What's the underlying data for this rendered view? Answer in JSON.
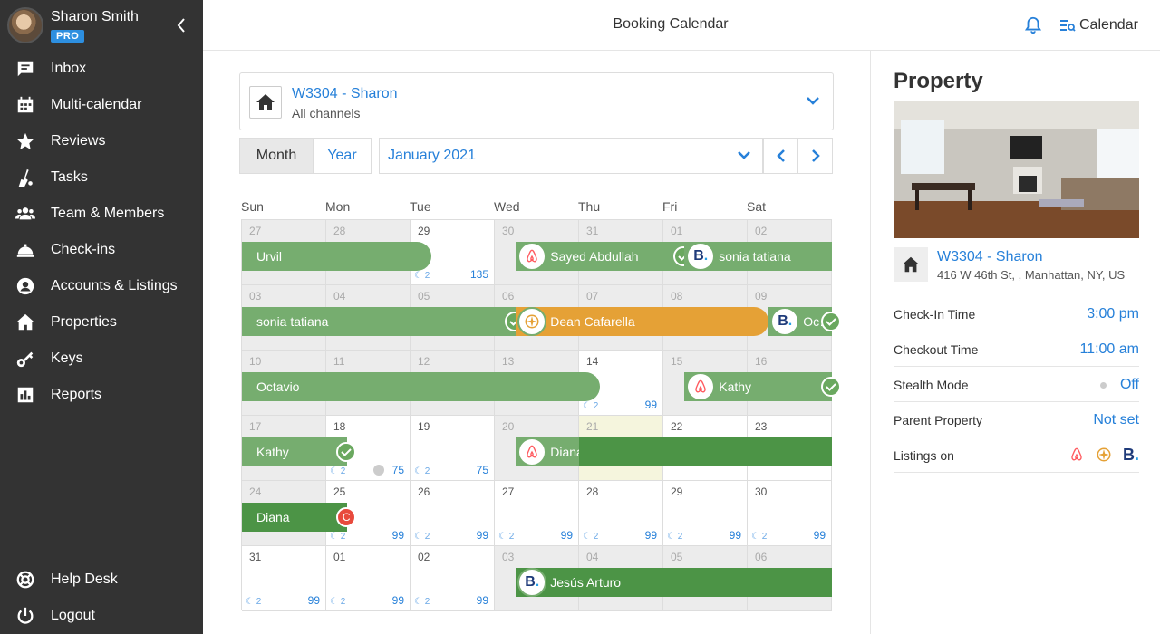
{
  "user": {
    "name": "Sharon Smith",
    "badge": "PRO"
  },
  "sidebar": {
    "items": [
      {
        "label": "Inbox",
        "icon": "inbox-icon"
      },
      {
        "label": "Multi-calendar",
        "icon": "calendar-grid-icon"
      },
      {
        "label": "Reviews",
        "icon": "star-icon"
      },
      {
        "label": "Tasks",
        "icon": "broom-icon"
      },
      {
        "label": "Team & Members",
        "icon": "team-icon"
      },
      {
        "label": "Check-ins",
        "icon": "bell-desk-icon"
      },
      {
        "label": "Accounts & Listings",
        "icon": "user-circle-icon"
      },
      {
        "label": "Properties",
        "icon": "home-icon"
      },
      {
        "label": "Keys",
        "icon": "key-icon"
      },
      {
        "label": "Reports",
        "icon": "reports-icon"
      }
    ],
    "bottom": [
      {
        "label": "Help Desk",
        "icon": "lifebuoy-icon"
      },
      {
        "label": "Logout",
        "icon": "power-icon"
      }
    ]
  },
  "header": {
    "title": "Booking Calendar",
    "calendar_label": "Calendar"
  },
  "property_selector": {
    "name": "W3304 - Sharon",
    "channels": "All channels"
  },
  "view": {
    "month_label": "Month",
    "year_label": "Year",
    "current": "January 2021"
  },
  "weekdays": [
    "Sun",
    "Mon",
    "Tue",
    "Wed",
    "Thu",
    "Fri",
    "Sat"
  ],
  "weeks": [
    [
      {
        "d": "27",
        "s": "past"
      },
      {
        "d": "28",
        "s": "past"
      },
      {
        "d": "29",
        "s": "fut",
        "moon": "2",
        "price": "135"
      },
      {
        "d": "30",
        "s": "past"
      },
      {
        "d": "31",
        "s": "past"
      },
      {
        "d": "01",
        "s": "past"
      },
      {
        "d": "02",
        "s": "past"
      }
    ],
    [
      {
        "d": "03",
        "s": "past"
      },
      {
        "d": "04",
        "s": "past"
      },
      {
        "d": "05",
        "s": "past"
      },
      {
        "d": "06",
        "s": "past"
      },
      {
        "d": "07",
        "s": "past"
      },
      {
        "d": "08",
        "s": "past"
      },
      {
        "d": "09",
        "s": "past"
      }
    ],
    [
      {
        "d": "10",
        "s": "past"
      },
      {
        "d": "11",
        "s": "past"
      },
      {
        "d": "12",
        "s": "past"
      },
      {
        "d": "13",
        "s": "past"
      },
      {
        "d": "14",
        "s": "fut",
        "moon": "2",
        "price": "99"
      },
      {
        "d": "15",
        "s": "past"
      },
      {
        "d": "16",
        "s": "past"
      }
    ],
    [
      {
        "d": "17",
        "s": "past"
      },
      {
        "d": "18",
        "s": "fut",
        "moon": "2",
        "price": "75",
        "dot": true
      },
      {
        "d": "19",
        "s": "fut",
        "moon": "2",
        "price": "75"
      },
      {
        "d": "20",
        "s": "past"
      },
      {
        "d": "21",
        "s": "today"
      },
      {
        "d": "22",
        "s": "fut"
      },
      {
        "d": "23",
        "s": "fut"
      }
    ],
    [
      {
        "d": "24",
        "s": "past"
      },
      {
        "d": "25",
        "s": "fut",
        "moon": "2",
        "price": "99"
      },
      {
        "d": "26",
        "s": "fut",
        "moon": "2",
        "price": "99"
      },
      {
        "d": "27",
        "s": "fut",
        "moon": "2",
        "price": "99"
      },
      {
        "d": "28",
        "s": "fut",
        "moon": "2",
        "price": "99"
      },
      {
        "d": "29",
        "s": "fut",
        "moon": "2",
        "price": "99"
      },
      {
        "d": "30",
        "s": "fut",
        "moon": "2",
        "price": "99"
      }
    ],
    [
      {
        "d": "31",
        "s": "fut",
        "moon": "2",
        "price": "99"
      },
      {
        "d": "01",
        "s": "fut",
        "moon": "2",
        "price": "99"
      },
      {
        "d": "02",
        "s": "fut",
        "moon": "2",
        "price": "99"
      },
      {
        "d": "03",
        "s": "past"
      },
      {
        "d": "04",
        "s": "past"
      },
      {
        "d": "05",
        "s": "past"
      },
      {
        "d": "06",
        "s": "past"
      }
    ]
  ],
  "bookings": [
    {
      "guest": "Urvil",
      "week": 0,
      "start": 0,
      "end": 2.25,
      "color": "green",
      "rounded": true
    },
    {
      "guest": "Sayed Abdullah",
      "week": 0,
      "start": 3.25,
      "end": 5.25,
      "color": "green",
      "channel": "airbnb",
      "check": true
    },
    {
      "guest": "sonia tatiana",
      "week": 0,
      "start": 5.25,
      "end": 7,
      "color": "green",
      "channel": "booking"
    },
    {
      "guest": "sonia tatiana",
      "week": 1,
      "start": 0,
      "end": 3.25,
      "color": "green",
      "check": true
    },
    {
      "guest": "Dean Cafarella",
      "week": 1,
      "start": 3.25,
      "end": 6.25,
      "color": "orange",
      "channel": "expedia",
      "rounded": true
    },
    {
      "guest": "Oc…",
      "week": 1,
      "start": 6.25,
      "end": 7,
      "color": "green",
      "channel": "booking",
      "check": true
    },
    {
      "guest": "Octavio",
      "week": 2,
      "start": 0,
      "end": 4.25,
      "color": "green",
      "rounded": true
    },
    {
      "guest": "Kathy",
      "week": 2,
      "start": 5.25,
      "end": 7,
      "color": "green",
      "channel": "airbnb",
      "check": true
    },
    {
      "guest": "Kathy",
      "week": 3,
      "start": 0,
      "end": 1.25,
      "color": "green",
      "check": true
    },
    {
      "guest": "Diana",
      "week": 3,
      "start": 3.25,
      "end": 4,
      "color": "green",
      "channel": "airbnb"
    },
    {
      "guest": "",
      "week": 3,
      "start": 4,
      "end": 7,
      "color": "dgreen"
    },
    {
      "guest": "Diana",
      "week": 4,
      "start": 0,
      "end": 1.25,
      "color": "dgreen",
      "cbadge": "C"
    },
    {
      "guest": "Jesús Arturo",
      "week": 5,
      "start": 3.25,
      "end": 7,
      "color": "dgreen",
      "channel": "booking"
    }
  ],
  "property_panel": {
    "title": "Property",
    "name": "W3304 - Sharon",
    "address": "416 W 46th St, , Manhattan, NY, US",
    "rows": [
      {
        "label": "Check-In Time",
        "value": "3:00 pm"
      },
      {
        "label": "Checkout Time",
        "value": "11:00 am"
      },
      {
        "label": "Stealth Mode",
        "value": "Off"
      },
      {
        "label": "Parent Property",
        "value": "Not set"
      },
      {
        "label": "Listings on",
        "value": ""
      }
    ]
  },
  "colors": {
    "sidebar": "#333333",
    "link": "#2680d9",
    "booking_green": "#76ad6f",
    "booking_dark_green": "#4c9446",
    "booking_orange": "#e5a136"
  }
}
